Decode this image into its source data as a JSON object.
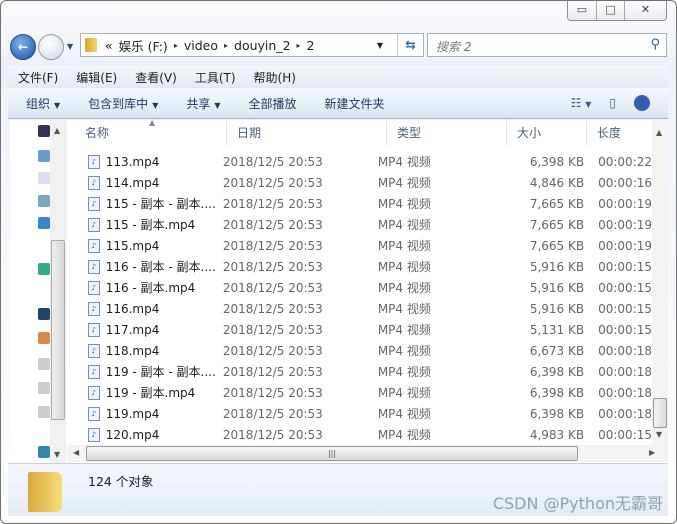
{
  "window": {
    "minimize": "▭",
    "maximize": "□",
    "close": "✕"
  },
  "address": {
    "overflow": "«",
    "parts": [
      "娱乐 (F:)",
      "video",
      "douyin_2",
      "2"
    ],
    "separator": "▸"
  },
  "search": {
    "placeholder": "搜索 2"
  },
  "menu": [
    "文件(F)",
    "编辑(E)",
    "查看(V)",
    "工具(T)",
    "帮助(H)"
  ],
  "toolbar": {
    "organize": "组织",
    "include": "包含到库中",
    "share": "共享",
    "play_all": "全部播放",
    "new_folder": "新建文件夹"
  },
  "columns": {
    "name": "名称",
    "date": "日期",
    "type": "类型",
    "size": "大小",
    "length": "长度"
  },
  "files": [
    {
      "name": "113.mp4",
      "date": "2018/12/5 20:53",
      "type": "MP4 视频",
      "size": "6,398 KB",
      "length": "00:00:22"
    },
    {
      "name": "114.mp4",
      "date": "2018/12/5 20:53",
      "type": "MP4 视频",
      "size": "4,846 KB",
      "length": "00:00:16"
    },
    {
      "name": "115 - 副本 - 副本....",
      "date": "2018/12/5 20:53",
      "type": "MP4 视频",
      "size": "7,665 KB",
      "length": "00:00:19"
    },
    {
      "name": "115 - 副本.mp4",
      "date": "2018/12/5 20:53",
      "type": "MP4 视频",
      "size": "7,665 KB",
      "length": "00:00:19"
    },
    {
      "name": "115.mp4",
      "date": "2018/12/5 20:53",
      "type": "MP4 视频",
      "size": "7,665 KB",
      "length": "00:00:19"
    },
    {
      "name": "116 - 副本 - 副本....",
      "date": "2018/12/5 20:53",
      "type": "MP4 视频",
      "size": "5,916 KB",
      "length": "00:00:15"
    },
    {
      "name": "116 - 副本.mp4",
      "date": "2018/12/5 20:53",
      "type": "MP4 视频",
      "size": "5,916 KB",
      "length": "00:00:15"
    },
    {
      "name": "116.mp4",
      "date": "2018/12/5 20:53",
      "type": "MP4 视频",
      "size": "5,916 KB",
      "length": "00:00:15"
    },
    {
      "name": "117.mp4",
      "date": "2018/12/5 20:53",
      "type": "MP4 视频",
      "size": "5,131 KB",
      "length": "00:00:15"
    },
    {
      "name": "118.mp4",
      "date": "2018/12/5 20:53",
      "type": "MP4 视频",
      "size": "6,673 KB",
      "length": "00:00:18"
    },
    {
      "name": "119 - 副本 - 副本....",
      "date": "2018/12/5 20:53",
      "type": "MP4 视频",
      "size": "6,398 KB",
      "length": "00:00:18"
    },
    {
      "name": "119 - 副本.mp4",
      "date": "2018/12/5 20:53",
      "type": "MP4 视频",
      "size": "6,398 KB",
      "length": "00:00:18"
    },
    {
      "name": "119.mp4",
      "date": "2018/12/5 20:53",
      "type": "MP4 视频",
      "size": "6,398 KB",
      "length": "00:00:18"
    },
    {
      "name": "120.mp4",
      "date": "2018/12/5 20:53",
      "type": "MP4 视频",
      "size": "4,983 KB",
      "length": "00:00:15"
    }
  ],
  "status": {
    "count": "124 个对象"
  },
  "watermark": "CSDN @Python无霸哥"
}
